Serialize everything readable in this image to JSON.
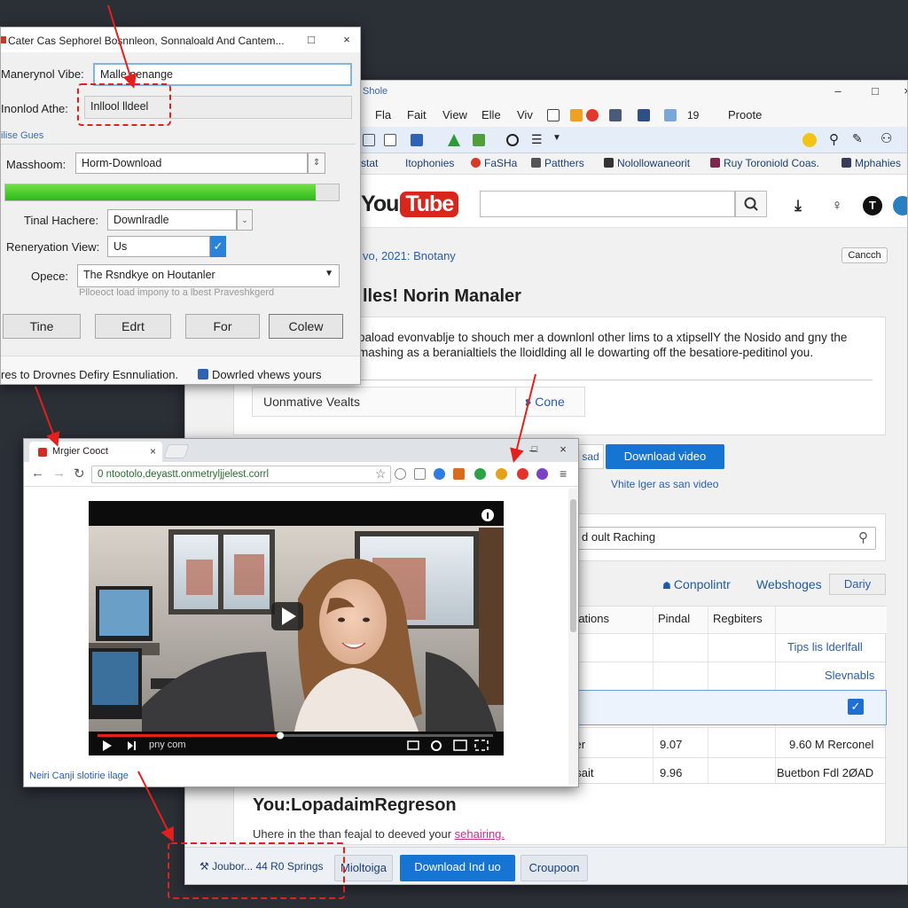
{
  "browser": {
    "window_title": "Shole",
    "menu": [
      "Fla",
      "Fait",
      "View",
      "Elle",
      "Viv"
    ],
    "menu_counter": "19",
    "menu_profile": "Proote",
    "bookmarks": [
      "stat",
      "Itophonies",
      "FaSHa",
      "Patthers",
      "Nolollowaneorit",
      "Ruy Toroniold Coas.",
      "Mphahies"
    ],
    "logo_you": "You",
    "logo_tube": "Tube",
    "date_line": "vo, 2021: Bnotany",
    "cancel_label": "Cancch",
    "heading": "lles! Norin Manaler",
    "description": "oaload evonvablje to shouch mer a downlonl other lims to a xtipsellY the Nosido and gny the mashing as a beranialtiels the lloidlding all le dowarting off the besatiore-peditinol you.",
    "alt_label": "Uonmative Vealts",
    "done_label": "Cone",
    "side_tab_label": "sad",
    "download_video_label": "Download video",
    "write_link": "Vhite lger as san video",
    "search_value": "d oult Raching",
    "tabs": {
      "compilation": "Conpolintr",
      "webshoges": "Webshoges",
      "display": "Dariy"
    },
    "table": {
      "headers": [
        "rations",
        "Pindal",
        "Regbiters"
      ],
      "rows": [
        {
          "c1": "",
          "c2": "",
          "c3": "Tips lis lderlfall"
        },
        {
          "c1": "",
          "c2": "",
          "c3": "Slevnabls"
        },
        {
          "c1": "e",
          "c2": "",
          "c3": ""
        },
        {
          "c1": "tler",
          "c2": "9.07",
          "c3": "9.60 M Rerconel"
        },
        {
          "c1": "nsait",
          "c2": "9.96",
          "c3": "Buetbon Fdl 2ØAD"
        }
      ]
    },
    "footer_title": "You:LopadaimRegreson",
    "footer_sub_pre": "Uhere in the than feajal to deeved your ",
    "footer_sub_link": "sehairing.",
    "bottom_label": "Joubor... 44 R0 Springs",
    "bottom_btn_1": "Mioltoiga",
    "bottom_btn_2": "Download Ind uo",
    "bottom_btn_3": "Croupoon"
  },
  "dialog": {
    "title": "Cater Cas Sephorel Bosnnleon, Sonnaloald And Cantem...",
    "row1_label": "Manerynol Vibe:",
    "row1_value": "Malle nenange",
    "row2_label": "Inonlod Athe:",
    "row2_value": "Inllool lldeel",
    "section": "ilise Gues",
    "mashoom_label": "Masshoom:",
    "mashoom_value": "Horm-Download",
    "progress_pct": 93,
    "hacher_label": "Tinal Hachere:",
    "hacher_value": "Downlradle",
    "regen_label": "Reneryation View:",
    "regen_value": "Us",
    "opece_label": "Opece:",
    "opece_value": "The Rsndkye on Houtanler",
    "hint": "Plloeoct load impony to a lbest Praveshkgerd",
    "buttons": [
      "Tine",
      "Edrt",
      "For",
      "Colew"
    ],
    "status_left": "res to Drovnes Defiry Esnnuliation.",
    "status_right": "Dowrled vhews yours"
  },
  "popup": {
    "tab_label": "Mrgier Cooct",
    "url": "0 ntootolo,deyastt.onmetryljjelest.corrl",
    "player_time": "pny com",
    "footer_link": "Neiri Canji slotirie ilage"
  }
}
